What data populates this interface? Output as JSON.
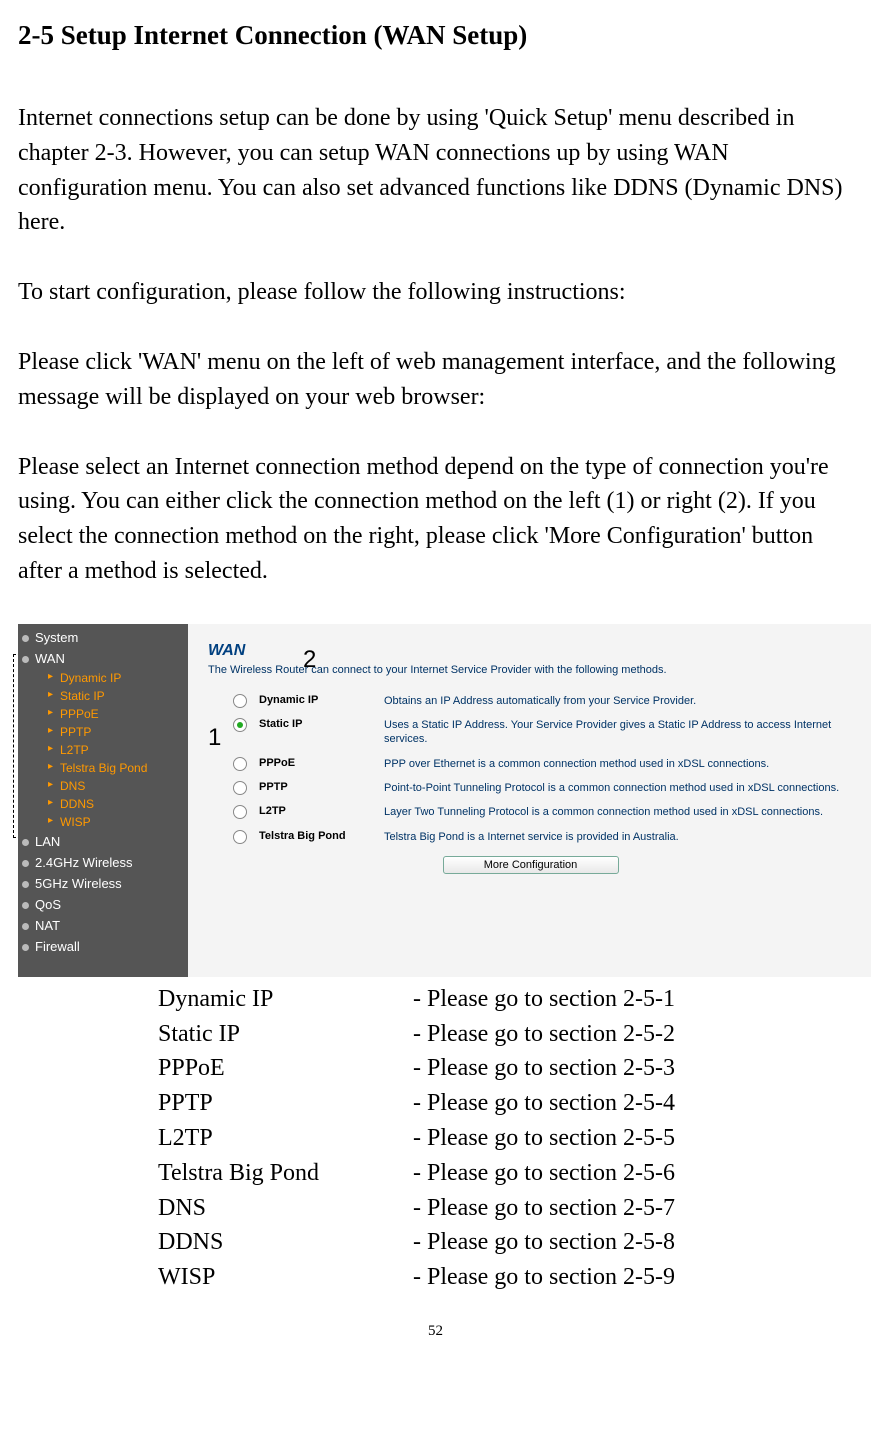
{
  "heading": "2-5 Setup Internet Connection (WAN Setup)",
  "paragraphs": {
    "p1": "Internet connections setup can be done by using 'Quick Setup' menu described in chapter 2-3. However, you can setup WAN connections up by using WAN configuration menu. You can also set advanced functions like DDNS (Dynamic DNS) here.",
    "p2": "To start configuration, please follow the following instructions:",
    "p3": "Please click 'WAN' menu on the left of web management interface, and the following message will be displayed on your web browser:",
    "p4": "Please select an Internet connection method depend on the type of connection you're using. You can either click the connection method on the left (1) or right (2). If you select the connection method on the right, please click 'More Configuration' button after a method is selected."
  },
  "screenshot": {
    "sidebar": {
      "items": [
        "System",
        "WAN",
        "LAN",
        "2.4GHz Wireless",
        "5GHz Wireless",
        "QoS",
        "NAT",
        "Firewall"
      ],
      "wan_sub": [
        "Dynamic IP",
        "Static IP",
        "PPPoE",
        "PPTP",
        "L2TP",
        "Telstra Big Pond",
        "DNS",
        "DDNS",
        "WISP"
      ]
    },
    "panel": {
      "title": "WAN",
      "desc": "The Wireless Router can connect to your Internet Service Provider with the following methods.",
      "options": [
        {
          "label": "Dynamic IP",
          "desc": "Obtains an IP Address automatically from your Service Provider.",
          "selected": false
        },
        {
          "label": "Static IP",
          "desc": "Uses a Static IP Address. Your Service Provider gives a Static IP Address to access Internet services.",
          "selected": true
        },
        {
          "label": "PPPoE",
          "desc": "PPP over Ethernet is a common connection method used in xDSL connections.",
          "selected": false
        },
        {
          "label": "PPTP",
          "desc": "Point-to-Point Tunneling Protocol is a common connection method used in xDSL connections.",
          "selected": false
        },
        {
          "label": "L2TP",
          "desc": "Layer Two Tunneling Protocol is a common connection method used in xDSL connections.",
          "selected": false
        },
        {
          "label": "Telstra Big Pond",
          "desc": "Telstra Big Pond is a Internet service is provided in Australia.",
          "selected": false
        }
      ],
      "button": "More Configuration"
    },
    "callouts": {
      "one": "1",
      "two": "2"
    }
  },
  "refs": [
    {
      "name": "Dynamic IP",
      "section": "- Please go to section 2-5-1"
    },
    {
      "name": "Static IP",
      "section": "- Please go to section 2-5-2"
    },
    {
      "name": "PPPoE",
      "section": "- Please go to section 2-5-3"
    },
    {
      "name": "PPTP",
      "section": "- Please go to section 2-5-4"
    },
    {
      "name": "L2TP",
      "section": "- Please go to section 2-5-5"
    },
    {
      "name": "Telstra Big Pond",
      "section": "- Please go to section 2-5-6"
    },
    {
      "name": "DNS",
      "section": "- Please go to section 2-5-7"
    },
    {
      "name": "DDNS",
      "section": "- Please go to section 2-5-8"
    },
    {
      "name": "WISP",
      "section": "- Please go to section 2-5-9"
    }
  ],
  "page_number": "52"
}
